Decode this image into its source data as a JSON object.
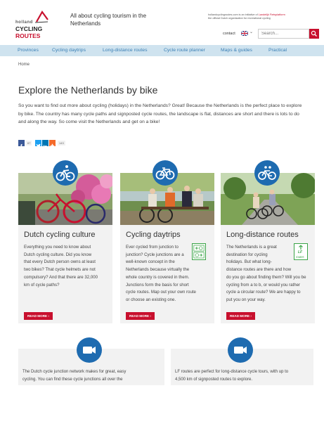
{
  "header": {
    "logo_top": "holland",
    "logo_cycling": "CYCLING",
    "logo_routes": "ROUTES",
    "tagline": "All about cycling tourism in the Netherlands",
    "initiative_site": "hollandcyclingroutes.com is an initiative of",
    "initiative_brand": "Landelijk Fietsplatform",
    "initiative_desc": "the official Dutch organisation for recreational cycling",
    "contact_label": "contact",
    "language_flag": "uk-flag-icon",
    "search_placeholder": "Search...",
    "search_icon": "search-icon"
  },
  "nav": {
    "items": [
      "Provinces",
      "Cycling daytrips",
      "Long-distance routes",
      "Cycle route planner",
      "Maps & guides",
      "Practical"
    ]
  },
  "breadcrumb": "Home",
  "main": {
    "title": "Explore the Netherlands by bike",
    "intro": "So you want to find out more about cycling (holidays) in the Netherlands? Great! Because the Netherlands is the perfect place to explore by bike. The country has many cycle paths and signposted cycle routes, the landscape is flat, distances are short and there is lots to do and along the way. So come visit the Netherlands and get on a bike!"
  },
  "social": {
    "facebook_count": "67",
    "total_count": "143"
  },
  "cards": [
    {
      "title": "Dutch cycling culture",
      "lines": [
        "Everything you need to know about",
        "Dutch cycling culture. Did you know",
        "that every Dutch person owns at least",
        "two bikes? That cycle helmets are not",
        "compulsory? And that there are 32,000",
        "km of cycle paths?"
      ],
      "read_more": "READ MORE"
    },
    {
      "title": "Cycling daytrips",
      "lines": [
        "Ever cycled from junction to",
        "junction? Cycle junctions are a",
        "well-known concept in the",
        "Netherlands because virtually the",
        "whole country is covered in them.",
        "Junctions form the basis for short",
        "cycle routes. Map out your own route",
        "or choose an existing one."
      ],
      "read_more": "READ MORE"
    },
    {
      "title": "Long-distance routes",
      "lines": [
        "The Netherlands is a great",
        "destination for cycling",
        "holidays. But what long-",
        "distance routes are there and how",
        "do you go about finding them? Will you be",
        "cycling from a to b, or would you rather",
        "cycle a circular route? We are happy to",
        "put you on your way."
      ],
      "read_more": "READ MORE",
      "badge_top": "LF",
      "badge_bottom": "routes"
    }
  ],
  "videos": [
    {
      "lines": [
        "The Dutch cycle junction network makes for great, easy",
        "cycling. You can find these cycle junctions all over the"
      ]
    },
    {
      "lines": [
        "LF routes are perfect for long-distance cycle tours, with up to",
        "4,500 km of signposted routes to explore."
      ]
    }
  ],
  "colors": {
    "accent_red": "#c8102e",
    "brand_blue": "#1e6bb0",
    "nav_bg": "#cfe3ef",
    "nav_text": "#3a7fb5",
    "junction_green": "#3aa447"
  }
}
